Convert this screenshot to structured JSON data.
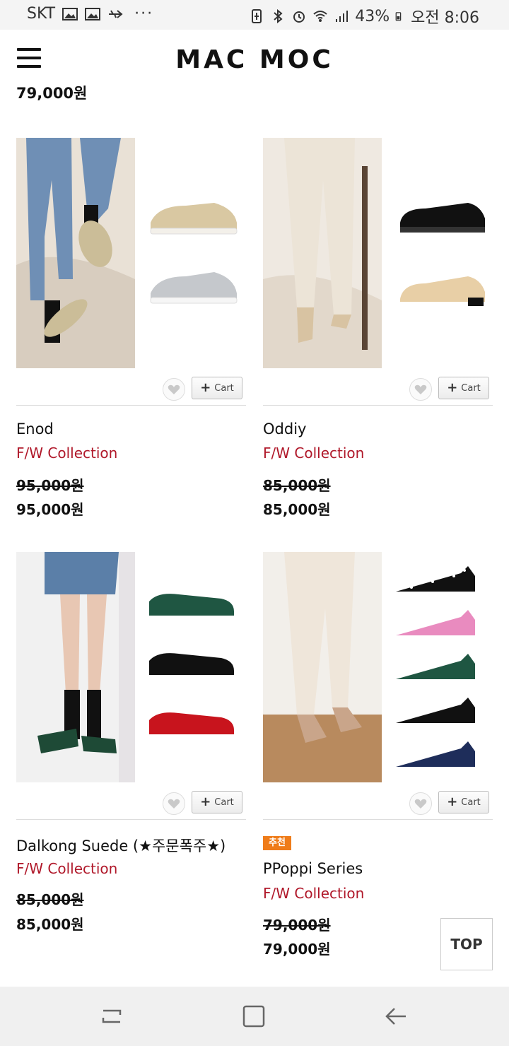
{
  "status_bar": {
    "carrier": "SKT",
    "dots": "···",
    "battery": "43%",
    "time": "오전 8:06"
  },
  "header": {
    "logo": "MAC MOC",
    "menu_icon": "hamburger-menu-icon"
  },
  "previous_item_price": "79,000원",
  "products": [
    {
      "name": "Enod",
      "collection": "F/W Collection",
      "original_price": "95,000원",
      "price": "95,000원",
      "cart_label": "Cart",
      "badge": ""
    },
    {
      "name": "Oddiy",
      "collection": "F/W Collection",
      "original_price": "85,000원",
      "price": "85,000원",
      "cart_label": "Cart",
      "badge": ""
    },
    {
      "name": "Dalkong Suede (★주문폭주★)",
      "collection": "F/W Collection",
      "original_price": "85,000원",
      "price": "85,000원",
      "cart_label": "Cart",
      "badge": ""
    },
    {
      "name": "PPoppi Series",
      "collection": "F/W Collection",
      "original_price": "79,000원",
      "price": "79,000원",
      "cart_label": "Cart",
      "badge": "추천"
    }
  ],
  "top_button": "TOP",
  "colors": {
    "collection": "#b0182a",
    "badge": "#ef7c1a"
  }
}
